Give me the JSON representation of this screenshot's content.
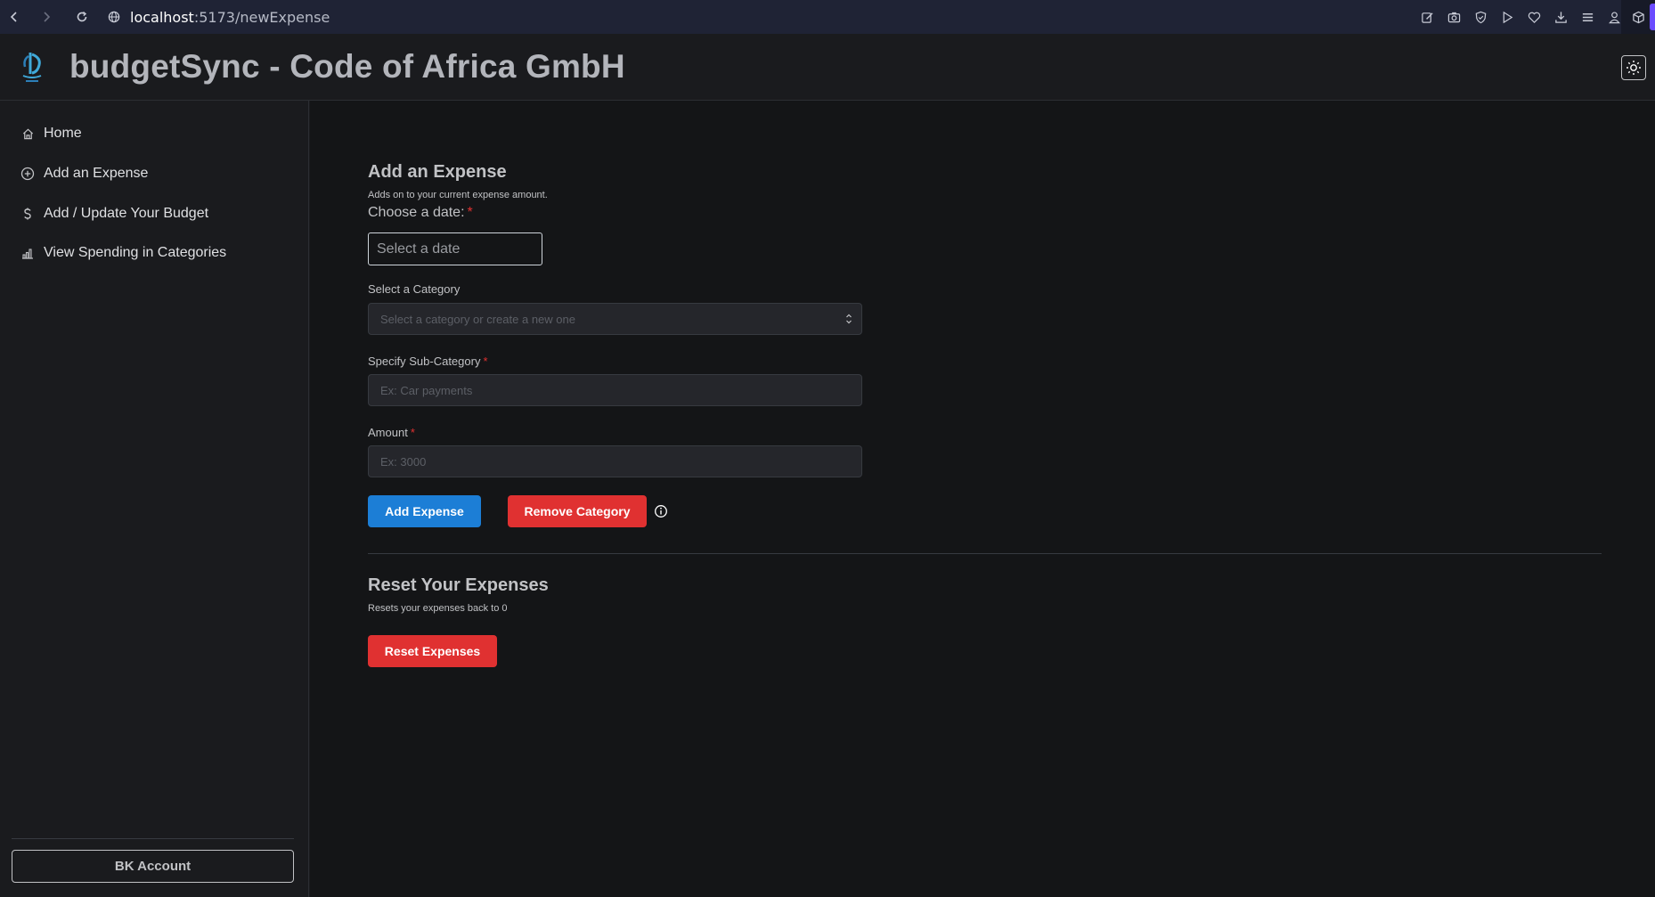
{
  "browser": {
    "url_host": "localhost",
    "url_path": ":5173/newExpense",
    "tool_icons": [
      "edit-icon",
      "camera-icon",
      "shield-icon",
      "play-icon",
      "heart-icon",
      "download-icon",
      "menu-icon",
      "profile-icon"
    ]
  },
  "header": {
    "title": "budgetSync - Code of Africa GmbH"
  },
  "sidebar": {
    "items": [
      {
        "label": "Home",
        "icon": "home-icon"
      },
      {
        "label": "Add an Expense",
        "icon": "plus-circle-icon"
      },
      {
        "label": "Add / Update Your Budget",
        "icon": "dollar-icon"
      },
      {
        "label": "View Spending in Categories",
        "icon": "bar-chart-icon"
      }
    ],
    "account_label": "BK Account"
  },
  "expense_form": {
    "title": "Add an Expense",
    "description": "Adds on to your current expense amount.",
    "date_label": "Choose a date:",
    "date_placeholder": "Select a date",
    "category_label": "Select a Category",
    "category_placeholder": "Select a category or create a new one",
    "subcategory_label": "Specify Sub-Category",
    "subcategory_placeholder": "Ex: Car payments",
    "amount_label": "Amount",
    "amount_placeholder": "Ex: 3000",
    "required_mark": "*",
    "add_button": "Add Expense",
    "remove_button": "Remove Category"
  },
  "reset_section": {
    "title": "Reset Your Expenses",
    "description": "Resets your expenses back to 0",
    "button": "Reset Expenses"
  },
  "colors": {
    "primary": "#1c7ed6",
    "danger": "#e03131",
    "background": "#141517",
    "sidebar": "#1a1b1e"
  }
}
